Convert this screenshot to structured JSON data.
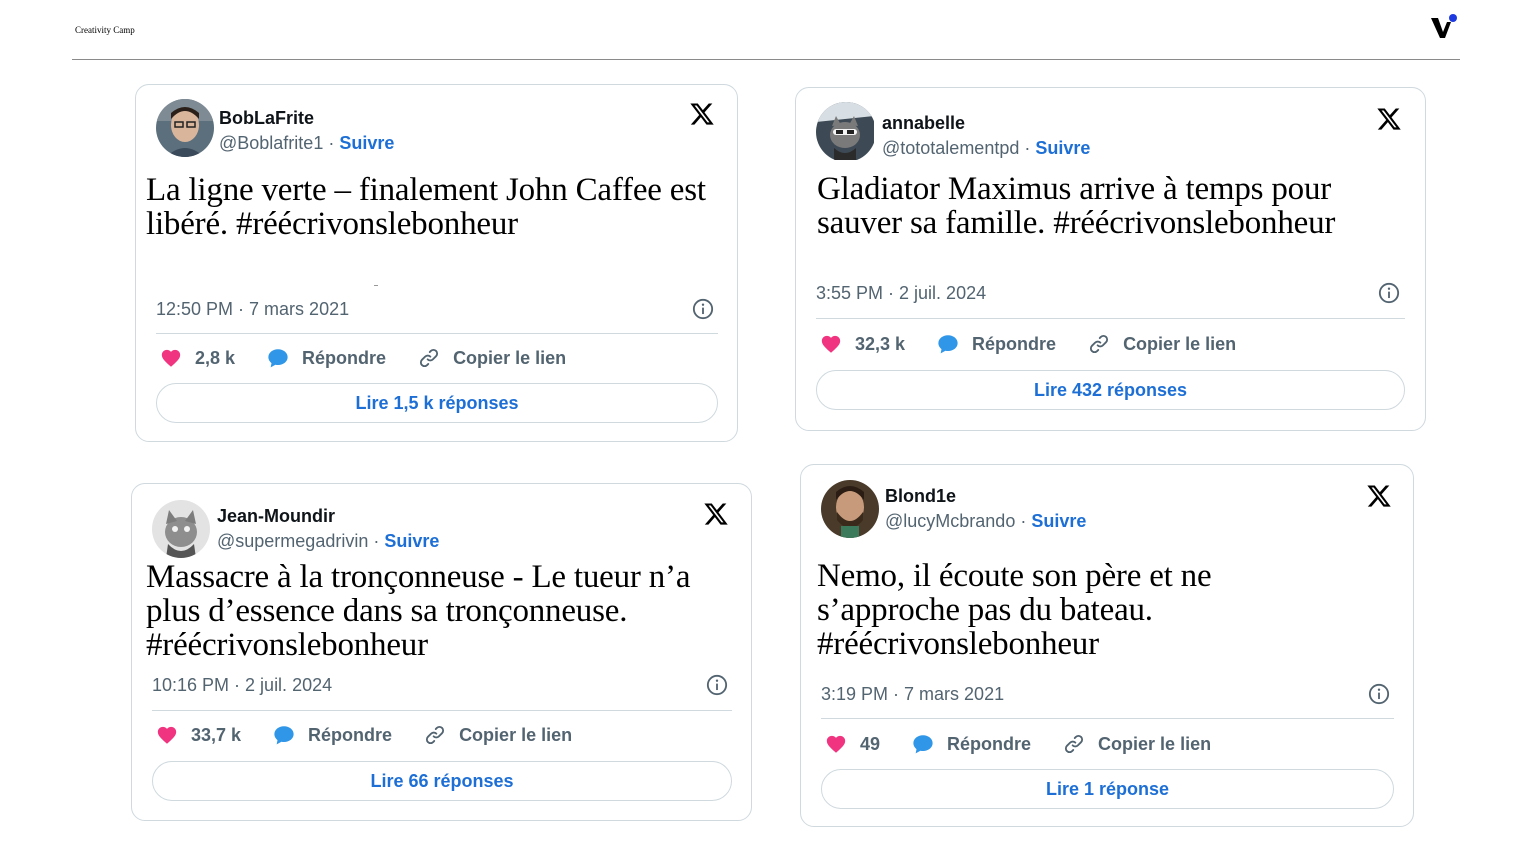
{
  "brand": "Creativity Camp",
  "colors": {
    "accent": "#1d6fd6",
    "like": "#f0347f",
    "reply": "#2f96e8",
    "muted": "#536471",
    "border": "#cfd9de"
  },
  "icons": {
    "logo": "brand-mark-icon",
    "x": "x-logo-icon",
    "like": "heart-icon",
    "reply": "speech-bubble-icon",
    "copy": "link-icon",
    "info": "info-icon"
  },
  "tweets": [
    {
      "name": "BobLaFrite",
      "handle": "@Boblafrite1",
      "sep": "·",
      "follow": "Suivre",
      "text": "La ligne verte – finalement John Caffee est libéré. #réécrivonslebonheur",
      "meta": "12:50 PM · 7 mars 2021",
      "likes": "2,8 k",
      "reply": "Répondre",
      "copy": "Copier le lien",
      "read": "Lire 1,5 k réponses"
    },
    {
      "name": "annabelle",
      "handle": "@tototalementpd",
      "sep": "·",
      "follow": "Suivre",
      "text": "Gladiator Maximus arrive à temps pour sauver sa famille. #réécrivonslebonheur",
      "meta": "3:55 PM · 2 juil. 2024",
      "likes": "32,3 k",
      "reply": "Répondre",
      "copy": "Copier le lien",
      "read": "Lire 432 réponses"
    },
    {
      "name": "Jean-Moundir",
      "handle": "@supermegadrivin",
      "sep": "·",
      "follow": "Suivre",
      "text": "Massacre à la tronçonneuse -  Le tueur n’a plus d’essence dans sa tronçonneuse. #réécrivonslebonheur",
      "meta": "10:16 PM · 2 juil. 2024",
      "likes": "33,7 k",
      "reply": "Répondre",
      "copy": "Copier le lien",
      "read": "Lire 66 réponses"
    },
    {
      "name": "Blond1e",
      "handle": "@lucyMcbrando",
      "sep": "·",
      "follow": "Suivre",
      "text": "Nemo, il écoute son père et ne s’approche pas du bateau. #réécrivonslebonheur",
      "meta": "3:19 PM · 7 mars 2021",
      "likes": "49",
      "reply": "Répondre",
      "copy": "Copier le lien",
      "read": "Lire 1 réponse"
    }
  ]
}
